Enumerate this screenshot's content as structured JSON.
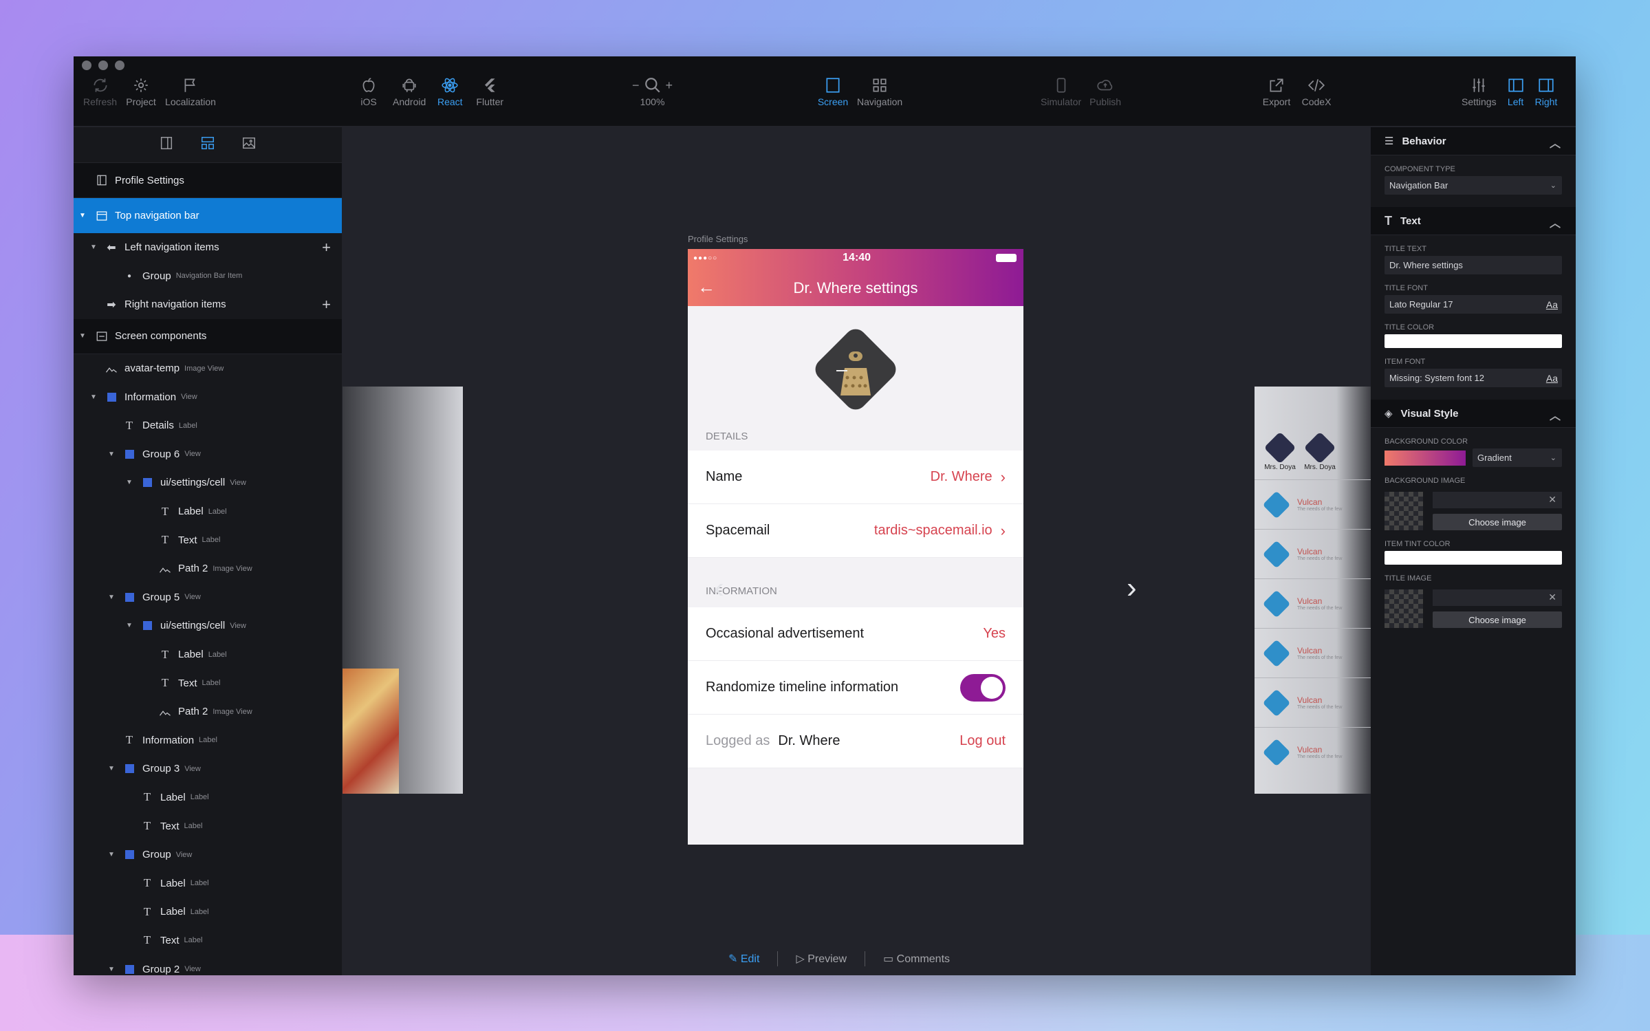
{
  "toolbar": {
    "refresh": "Refresh",
    "project": "Project",
    "localization": "Localization",
    "ios": "iOS",
    "android": "Android",
    "react": "React",
    "flutter": "Flutter",
    "zoom": "100%",
    "screen": "Screen",
    "navigation": "Navigation",
    "simulator": "Simulator",
    "publish": "Publish",
    "export": "Export",
    "codex": "CodeX",
    "settings": "Settings",
    "left": "Left",
    "right": "Right"
  },
  "tree": {
    "root": "Profile Settings",
    "selected": "Top navigation bar",
    "rows": [
      {
        "label": "Left navigation items",
        "type": "",
        "level": 1,
        "arrow": "▼",
        "icon": "arrow-left-icon",
        "plus": true
      },
      {
        "label": "Group",
        "type": "Navigation Bar Item",
        "level": 2,
        "arrow": "",
        "icon": "dot-icon",
        "plus": false
      },
      {
        "label": "Right navigation items",
        "type": "",
        "level": 1,
        "arrow": "",
        "icon": "arrow-right-icon",
        "plus": true
      }
    ],
    "screen_components": "Screen components",
    "components": [
      {
        "label": "avatar-temp",
        "type": "Image View",
        "level": 1,
        "arrow": "",
        "icon": "image"
      },
      {
        "label": "Information",
        "type": "View",
        "level": 1,
        "arrow": "▼",
        "icon": "view"
      },
      {
        "label": "Details",
        "type": "Label",
        "level": 2,
        "arrow": "",
        "icon": "text"
      },
      {
        "label": "Group 6",
        "type": "View",
        "level": 2,
        "arrow": "▼",
        "icon": "view"
      },
      {
        "label": "ui/settings/cell",
        "type": "View",
        "level": 3,
        "arrow": "▼",
        "icon": "view"
      },
      {
        "label": "Label",
        "type": "Label",
        "level": 4,
        "arrow": "",
        "icon": "text"
      },
      {
        "label": "Text",
        "type": "Label",
        "level": 4,
        "arrow": "",
        "icon": "text"
      },
      {
        "label": "Path 2",
        "type": "Image View",
        "level": 4,
        "arrow": "",
        "icon": "image"
      },
      {
        "label": "Group 5",
        "type": "View",
        "level": 2,
        "arrow": "▼",
        "icon": "view"
      },
      {
        "label": "ui/settings/cell",
        "type": "View",
        "level": 3,
        "arrow": "▼",
        "icon": "view"
      },
      {
        "label": "Label",
        "type": "Label",
        "level": 4,
        "arrow": "",
        "icon": "text"
      },
      {
        "label": "Text",
        "type": "Label",
        "level": 4,
        "arrow": "",
        "icon": "text"
      },
      {
        "label": "Path 2",
        "type": "Image View",
        "level": 4,
        "arrow": "",
        "icon": "image"
      },
      {
        "label": "Information",
        "type": "Label",
        "level": 2,
        "arrow": "",
        "icon": "text"
      },
      {
        "label": "Group 3",
        "type": "View",
        "level": 2,
        "arrow": "▼",
        "icon": "view"
      },
      {
        "label": "Label",
        "type": "Label",
        "level": 3,
        "arrow": "",
        "icon": "text"
      },
      {
        "label": "Text",
        "type": "Label",
        "level": 3,
        "arrow": "",
        "icon": "text"
      },
      {
        "label": "Group",
        "type": "View",
        "level": 2,
        "arrow": "▼",
        "icon": "view"
      },
      {
        "label": "Label",
        "type": "Label",
        "level": 3,
        "arrow": "",
        "icon": "text"
      },
      {
        "label": "Label",
        "type": "Label",
        "level": 3,
        "arrow": "",
        "icon": "text"
      },
      {
        "label": "Text",
        "type": "Label",
        "level": 3,
        "arrow": "",
        "icon": "text"
      },
      {
        "label": "Group 2",
        "type": "View",
        "level": 2,
        "arrow": "▼",
        "icon": "view"
      }
    ]
  },
  "phone": {
    "frame_label": "Profile Settings",
    "time": "14:40",
    "title": "Dr. Where settings",
    "details_header": "DETAILS",
    "name_label": "Name",
    "name_value": "Dr. Where",
    "spacemail_label": "Spacemail",
    "spacemail_value": "tardis~spacemail.io",
    "information_header": "INFORMATION",
    "ads_label": "Occasional advertisement",
    "ads_value": "Yes",
    "randomize_label": "Randomize timeline information",
    "logged_as": "Logged as",
    "logged_user": "Dr. Where",
    "logout": "Log out"
  },
  "ghost_right": {
    "avatars": [
      "Mrs. Doya",
      "Mrs. Doya"
    ],
    "item": "Vulcan",
    "item_sub": "The needs of the few"
  },
  "bottom": {
    "edit": "Edit",
    "preview": "Preview",
    "comments": "Comments"
  },
  "props": {
    "behavior": "Behavior",
    "component_type_label": "COMPONENT TYPE",
    "component_type": "Navigation Bar",
    "text": "Text",
    "title_text_label": "TITLE TEXT",
    "title_text": "Dr. Where settings",
    "title_font_label": "TITLE FONT",
    "title_font": "Lato Regular 17",
    "title_color_label": "TITLE COLOR",
    "item_font_label": "ITEM FONT",
    "item_font": "Missing: System font 12",
    "aa": "Aa",
    "visual_style": "Visual Style",
    "bg_color_label": "BACKGROUND COLOR",
    "bg_color_mode": "Gradient",
    "bg_image_label": "BACKGROUND IMAGE",
    "choose_image": "Choose image",
    "item_tint_label": "ITEM TINT COLOR",
    "title_image_label": "TITLE IMAGE"
  },
  "colors": {
    "accent": "#3b9ff3",
    "selection": "#0f7bd4",
    "red": "#d6434f",
    "purple": "#8e1b95"
  }
}
